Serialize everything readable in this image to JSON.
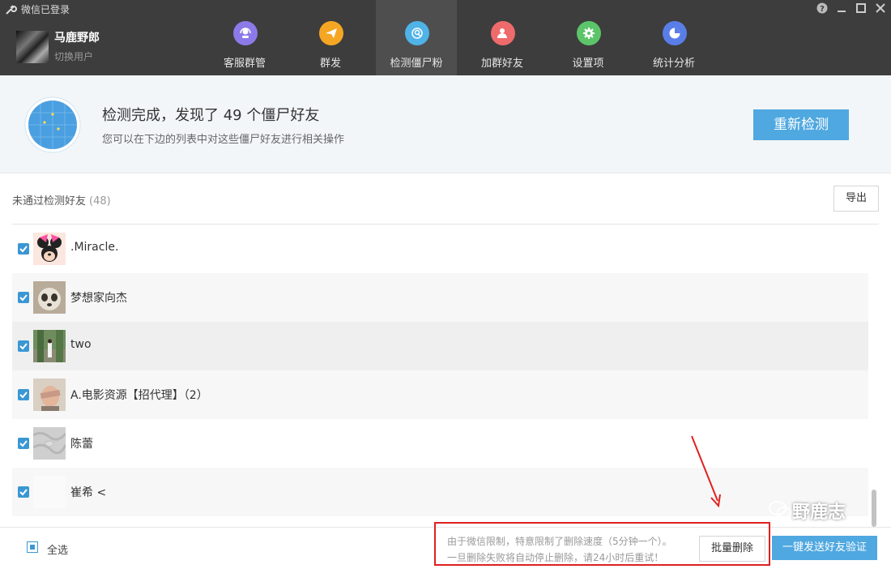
{
  "window": {
    "title": "微信已登录"
  },
  "user": {
    "name": "马鹿野郎",
    "switch_label": "切换用户"
  },
  "nav": {
    "tabs": [
      {
        "label": "客服群管",
        "icon": "customer-service-icon",
        "color": "#8b7ae8"
      },
      {
        "label": "群发",
        "icon": "paper-plane-icon",
        "color": "#f5a623"
      },
      {
        "label": "检测僵尸粉",
        "icon": "detect-zombie-icon",
        "color": "#4fb3e8",
        "active": true
      },
      {
        "label": "加群好友",
        "icon": "add-friend-icon",
        "color": "#ef6b6b"
      },
      {
        "label": "设置项",
        "icon": "gear-icon",
        "color": "#5cc56a"
      },
      {
        "label": "统计分析",
        "icon": "pie-chart-icon",
        "color": "#5a7ee8"
      }
    ]
  },
  "banner": {
    "title": "检测完成，发现了 49 个僵尸好友",
    "subtitle": "您可以在下边的列表中对这些僵尸好友进行相关操作",
    "recheck_label": "重新检测"
  },
  "list": {
    "header_label": "未通过检测好友",
    "count": "(48)",
    "export_label": "导出",
    "items": [
      {
        "name": ".Miracle.",
        "checked": true,
        "avatar": "minnie-mouse-avatar"
      },
      {
        "name": "梦想家向杰",
        "checked": true,
        "avatar": "panda-avatar"
      },
      {
        "name": "two",
        "checked": true,
        "avatar": "person-outdoor-avatar"
      },
      {
        "name": "A.电影资源【招代理】（2）",
        "checked": true,
        "avatar": "person-face-avatar"
      },
      {
        "name": "陈蕾",
        "checked": true,
        "avatar": "gray-fabric-avatar"
      },
      {
        "name": "崔希 <",
        "checked": true,
        "avatar": "blank-avatar"
      }
    ]
  },
  "footer": {
    "select_all_label": "全选",
    "notice_line1": "由于微信限制，特意限制了删除速度（5分钟一个）。",
    "notice_line2": "一旦删除失败将自动停止删除，请24小时后重试！",
    "batch_delete_label": "批量删除",
    "verify_label": "一键发送好友验证"
  },
  "watermark": {
    "text": "野鹿志"
  },
  "colors": {
    "accent": "#4fa8e0",
    "topbar": "#3d3d3d",
    "highlight_border": "#e02020"
  }
}
